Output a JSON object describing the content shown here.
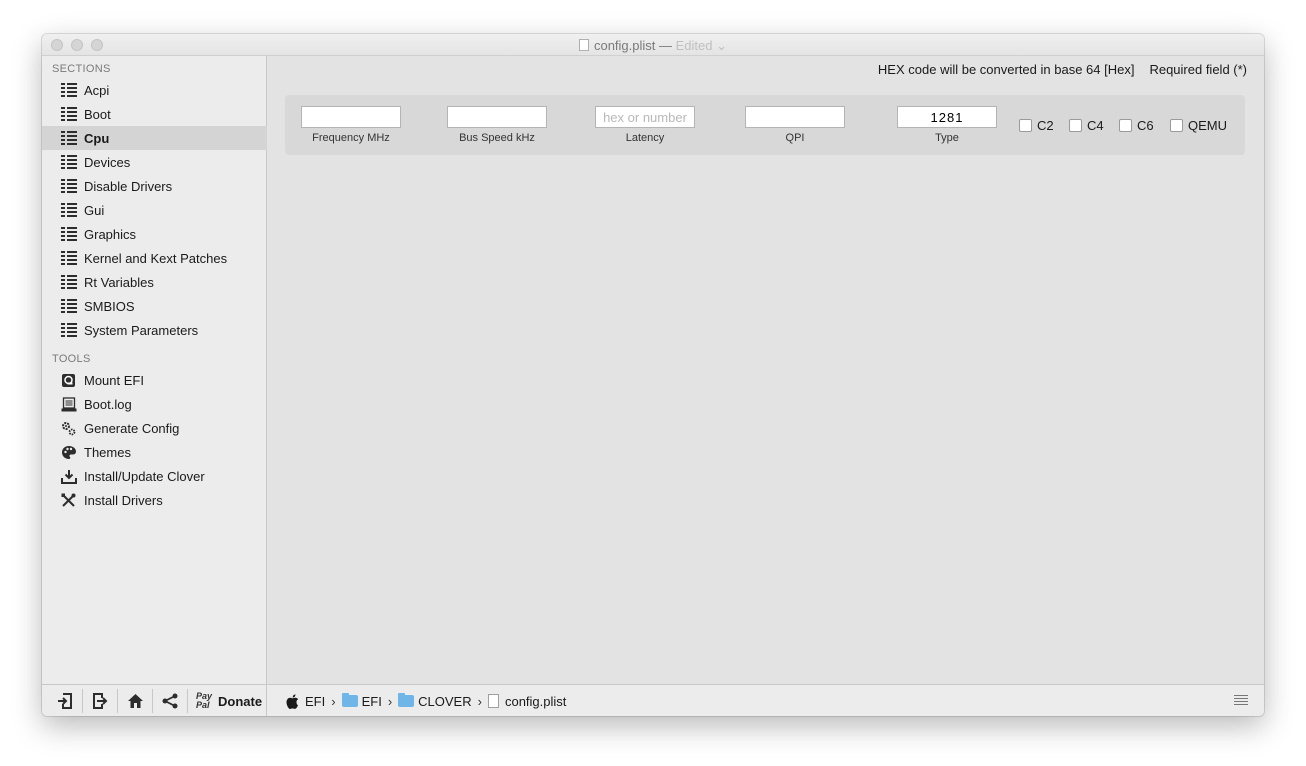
{
  "window": {
    "title": "config.plist",
    "title_separator": "—",
    "edited_label": "Edited"
  },
  "sidebar": {
    "sections_header": "SECTIONS",
    "sections": [
      {
        "label": "Acpi",
        "icon": "list-icon"
      },
      {
        "label": "Boot",
        "icon": "list-icon"
      },
      {
        "label": "Cpu",
        "icon": "list-icon",
        "selected": true
      },
      {
        "label": "Devices",
        "icon": "list-icon"
      },
      {
        "label": "Disable Drivers",
        "icon": "list-icon"
      },
      {
        "label": "Gui",
        "icon": "list-icon"
      },
      {
        "label": "Graphics",
        "icon": "list-icon"
      },
      {
        "label": "Kernel and Kext Patches",
        "icon": "list-icon"
      },
      {
        "label": "Rt Variables",
        "icon": "list-icon"
      },
      {
        "label": "SMBIOS",
        "icon": "list-icon"
      },
      {
        "label": "System Parameters",
        "icon": "list-icon"
      }
    ],
    "tools_header": "TOOLS",
    "tools": [
      {
        "label": "Mount EFI",
        "icon": "disk-icon"
      },
      {
        "label": "Boot.log",
        "icon": "log-icon"
      },
      {
        "label": "Generate Config",
        "icon": "gears-icon"
      },
      {
        "label": "Themes",
        "icon": "palette-icon"
      },
      {
        "label": "Install/Update Clover",
        "icon": "download-icon"
      },
      {
        "label": "Install Drivers",
        "icon": "tools-icon"
      }
    ]
  },
  "content": {
    "hex_notice": "HEX code will be converted in base 64 [Hex]",
    "required_notice": "Required field (*)",
    "fields": {
      "frequency": {
        "label": "Frequency MHz",
        "value": "",
        "placeholder": ""
      },
      "bus_speed": {
        "label": "Bus Speed kHz",
        "value": "",
        "placeholder": ""
      },
      "latency": {
        "label": "Latency",
        "value": "",
        "placeholder": "hex or number"
      },
      "qpi": {
        "label": "QPI",
        "value": "",
        "placeholder": ""
      },
      "type": {
        "label": "Type",
        "value": "1281",
        "placeholder": ""
      }
    },
    "checkboxes": [
      {
        "label": "C2",
        "checked": false
      },
      {
        "label": "C4",
        "checked": false
      },
      {
        "label": "C6",
        "checked": false
      },
      {
        "label": "QEMU",
        "checked": false
      }
    ]
  },
  "bottombar": {
    "buttons": [
      "import-icon",
      "export-icon",
      "home-icon",
      "share-icon"
    ],
    "paypal_line1": "Pay",
    "paypal_line2": "Pal",
    "donate_label": "Donate",
    "breadcrumb": [
      {
        "label": "EFI",
        "icon": "apple-icon"
      },
      {
        "label": "EFI",
        "icon": "folder-icon"
      },
      {
        "label": "CLOVER",
        "icon": "folder-icon"
      },
      {
        "label": "config.plist",
        "icon": "file-icon"
      }
    ],
    "breadcrumb_separator": "›"
  },
  "colors": {
    "window_bg": "#e3e3e3",
    "sidebar_bg": "#ececec",
    "selected_bg": "#d4d4d4",
    "panel_bg": "#d8d8d8",
    "folder": "#6fb5e8"
  }
}
